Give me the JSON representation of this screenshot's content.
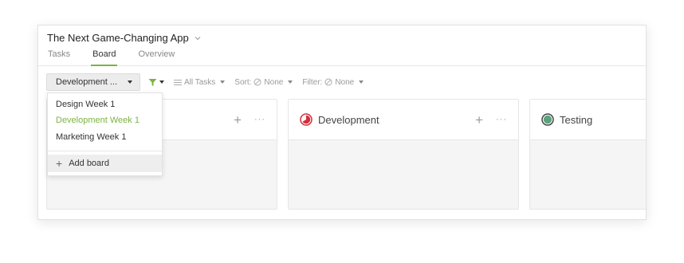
{
  "app": {
    "title": "The Next Game-Changing App"
  },
  "tabs": [
    {
      "label": "Tasks",
      "active": false
    },
    {
      "label": "Board",
      "active": true
    },
    {
      "label": "Overview",
      "active": false
    }
  ],
  "toolbar": {
    "board_select": "Development ...",
    "all_tasks": "All Tasks",
    "sort_label": "Sort:",
    "sort_value": "None",
    "filter_label": "Filter:",
    "filter_value": "None"
  },
  "dropdown": {
    "items": [
      {
        "label": "Design Week 1",
        "active": false
      },
      {
        "label": "Development Week 1",
        "active": true
      },
      {
        "label": "Marketing Week 1",
        "active": false
      }
    ],
    "add_label": "Add board"
  },
  "columns": [
    {
      "title": "",
      "icon": "none"
    },
    {
      "title": "Development",
      "icon": "progress-pie-red-icon"
    },
    {
      "title": "Testing",
      "icon": "progress-pie-green-icon"
    }
  ],
  "colors": {
    "accent": "#7cb342",
    "development": "#d32f3b",
    "testing": "#5aa37c"
  }
}
